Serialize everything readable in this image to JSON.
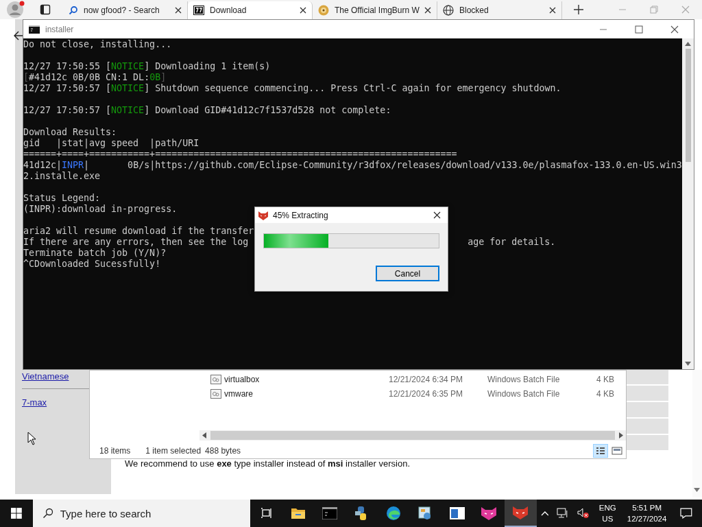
{
  "browser": {
    "tabs": [
      {
        "title": "now gfood? - Search",
        "kind": "search",
        "selected": false
      },
      {
        "title": "Download",
        "kind": "archive",
        "selected": true
      },
      {
        "title": "The Official ImgBurn W",
        "kind": "disc",
        "selected": false
      },
      {
        "title": "Blocked",
        "kind": "globe",
        "selected": false
      }
    ],
    "sidebar_links": [
      "Vietnamese",
      "7-max"
    ],
    "notice": "We recommend to use **exe** type installer instead of **msi** installer version."
  },
  "explorer": {
    "files": [
      {
        "name": "virtualbox",
        "modified": "12/21/2024 6:34 PM",
        "type": "Windows Batch File",
        "size": "4 KB"
      },
      {
        "name": "vmware",
        "modified": "12/21/2024 6:35 PM",
        "type": "Windows Batch File",
        "size": "4 KB"
      }
    ],
    "status": {
      "count": "18 items",
      "selection": "1 item selected",
      "size": "488 bytes"
    }
  },
  "terminal": {
    "title": "installer",
    "lines": [
      {
        "kind": "text",
        "segments": [
          {
            "text": "Do not close, installing...",
            "kind": "plain"
          }
        ]
      },
      {
        "kind": "blank"
      },
      {
        "kind": "text",
        "segments": [
          {
            "text": "12/27 17:50:55 [",
            "kind": "plain"
          },
          {
            "text": "NOTICE",
            "kind": "notice"
          },
          {
            "text": "] Downloading 1 item(s)",
            "kind": "plain"
          }
        ]
      },
      {
        "kind": "text",
        "segments": [
          {
            "text": "[",
            "kind": "dim"
          },
          {
            "text": "#41d12c 0B/0B CN:1 DL:",
            "kind": "plain"
          },
          {
            "text": "0B",
            "kind": "notice"
          },
          {
            "text": "]",
            "kind": "dim"
          }
        ]
      },
      {
        "kind": "text",
        "segments": [
          {
            "text": "12/27 17:50:57 [",
            "kind": "plain"
          },
          {
            "text": "NOTICE",
            "kind": "notice"
          },
          {
            "text": "] Shutdown sequence commencing... Press Ctrl-C again for emergency shutdown.",
            "kind": "plain"
          }
        ]
      },
      {
        "kind": "blank"
      },
      {
        "kind": "text",
        "segments": [
          {
            "text": "12/27 17:50:57 [",
            "kind": "plain"
          },
          {
            "text": "NOTICE",
            "kind": "notice"
          },
          {
            "text": "] Download GID#41d12c7f1537d528 not complete:",
            "kind": "plain"
          }
        ]
      },
      {
        "kind": "blank"
      },
      {
        "kind": "text",
        "segments": [
          {
            "text": "Download Results:",
            "kind": "plain"
          }
        ]
      },
      {
        "kind": "text",
        "segments": [
          {
            "text": "gid   |stat|avg speed  |path/URI",
            "kind": "plain"
          }
        ]
      },
      {
        "kind": "text",
        "segments": [
          {
            "text": "======+====+===========+=======================================================",
            "kind": "plain"
          }
        ]
      },
      {
        "kind": "text",
        "segments": [
          {
            "text": "41d12c|",
            "kind": "plain"
          },
          {
            "text": "INPR",
            "kind": "status"
          },
          {
            "text": "|       0B/s|https://github.com/Eclipse-Community/r3dfox/releases/download/v133.0e/plasmafox-133.0.en-US.win3",
            "kind": "plain"
          }
        ]
      },
      {
        "kind": "text",
        "segments": [
          {
            "text": "2.installe.exe",
            "kind": "plain"
          }
        ]
      },
      {
        "kind": "blank"
      },
      {
        "kind": "text",
        "segments": [
          {
            "text": "Status Legend:",
            "kind": "plain"
          }
        ]
      },
      {
        "kind": "text",
        "segments": [
          {
            "text": "(INPR):download in-progress.",
            "kind": "plain"
          }
        ]
      },
      {
        "kind": "blank"
      },
      {
        "kind": "text",
        "segments": [
          {
            "text": "aria2 will resume download if the transfer",
            "kind": "plain"
          }
        ]
      },
      {
        "kind": "text",
        "segments": [
          {
            "text": "If there are any errors, then see the log",
            "kind": "plain"
          },
          {
            "text": "age for details.",
            "kind": "tail"
          }
        ]
      },
      {
        "kind": "text",
        "segments": [
          {
            "text": "Terminate batch job (Y/N)?",
            "kind": "plain"
          }
        ]
      },
      {
        "kind": "text",
        "segments": [
          {
            "text": "^CDownloaded Sucessfully!",
            "kind": "plain"
          }
        ]
      }
    ]
  },
  "dialog": {
    "title": "45% Extracting",
    "level": 0.37,
    "button": "Cancel"
  },
  "taskbar": {
    "search_placeholder": "Type here to search",
    "apps": [
      {
        "kind": "task-view",
        "selected": false
      },
      {
        "kind": "folder",
        "selected": false
      },
      {
        "kind": "console",
        "selected": false
      },
      {
        "kind": "python",
        "selected": false
      },
      {
        "kind": "edge",
        "selected": false
      },
      {
        "kind": "control",
        "selected": false
      },
      {
        "kind": "window",
        "selected": false
      },
      {
        "kind": "cat-pink",
        "selected": false
      },
      {
        "kind": "cat-red",
        "selected": true
      }
    ],
    "language": "ENG",
    "region": "US",
    "time": "5:51 PM",
    "date": "12/27/2024"
  }
}
